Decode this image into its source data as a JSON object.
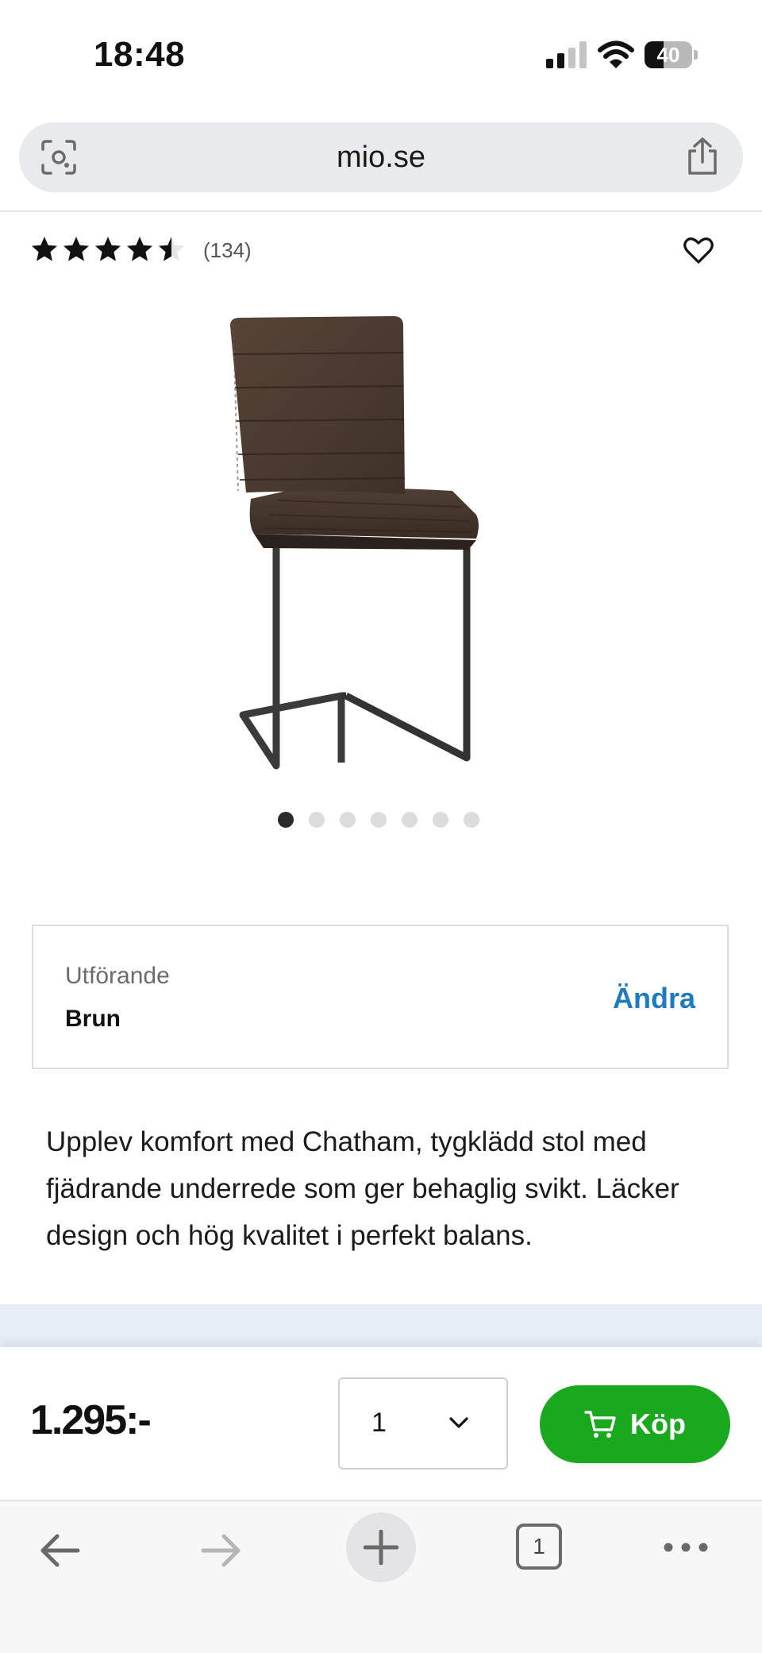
{
  "status_bar": {
    "time": "18:48",
    "battery": "40",
    "battery_level": 0.4
  },
  "browser": {
    "url": "mio.se",
    "tab_count": "1",
    "icons": [
      "lens-icon",
      "share-icon",
      "back-icon",
      "forward-icon",
      "plus-icon",
      "tabs-icon",
      "more-icon"
    ]
  },
  "product": {
    "rating": 4.5,
    "max_rating": 5,
    "review_count": "(134)",
    "image_count": 7,
    "active_image": 1,
    "variant": {
      "label": "Utförande",
      "value": "Brun",
      "change_label": "Ändra"
    },
    "description": "Upplev komfort med Chatham, tygklädd stol med fjädrande underrede som ger behaglig svikt. Läcker design och hög kvalitet i perfekt balans.",
    "price": "1.295:-",
    "quantity": "1",
    "buy_label": "Köp"
  },
  "colors": {
    "buy_button": "#1aa81e",
    "link": "#1f7bbf",
    "strip": "#e7eef5"
  }
}
